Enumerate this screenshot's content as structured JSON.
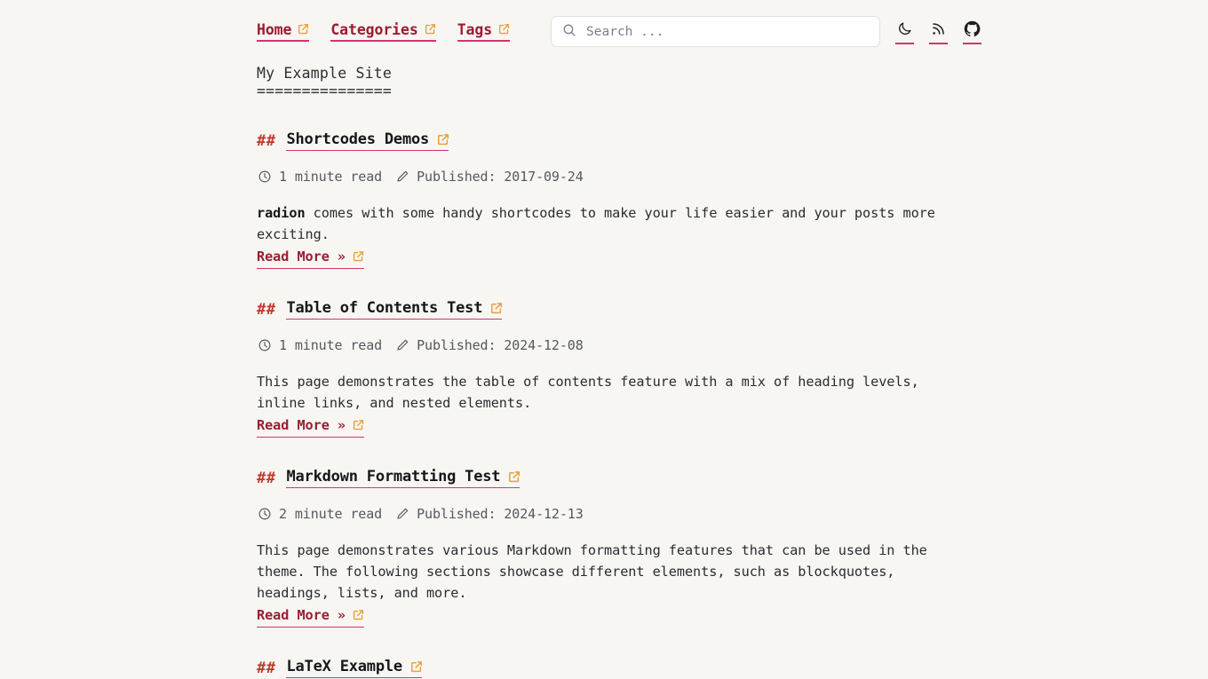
{
  "header": {
    "nav": [
      {
        "label": "Home",
        "icon": "external-link-icon"
      },
      {
        "label": "Categories",
        "icon": "external-link-icon"
      },
      {
        "label": "Tags",
        "icon": "external-link-icon"
      }
    ],
    "search": {
      "placeholder": "Search ...",
      "value": "",
      "icon": "search-icon"
    },
    "icons": [
      {
        "name": "moon-icon",
        "title": "Toggle dark mode"
      },
      {
        "name": "rss-icon",
        "title": "RSS feed"
      },
      {
        "name": "github-icon",
        "title": "GitHub"
      }
    ]
  },
  "site": {
    "title": "My Example Site",
    "rule": "==============="
  },
  "posts": [
    {
      "hash": "##",
      "title": "Shortcodes Demos",
      "read_time": "1 minute read",
      "published": "Published: 2017-09-24",
      "summary_lead": "radion",
      "summary": " comes with some handy shortcodes to make your life easier and your posts more exciting.",
      "read_more": "Read More »"
    },
    {
      "hash": "##",
      "title": "Table of Contents Test",
      "read_time": "1 minute read",
      "published": "Published: 2024-12-08",
      "summary_lead": "",
      "summary": "This page demonstrates the table of contents feature with a mix of heading levels, inline links, and nested elements.",
      "read_more": "Read More »"
    },
    {
      "hash": "##",
      "title": "Markdown Formatting Test",
      "read_time": "2 minute read",
      "published": "Published: 2024-12-13",
      "summary_lead": "",
      "summary": "This page demonstrates various Markdown formatting features that can be used in the theme. The following sections showcase different elements, such as blockquotes, headings, lists, and more.",
      "read_more": "Read More »"
    },
    {
      "hash": "##",
      "title": "LaTeX Example",
      "read_time": "",
      "published": "",
      "summary_lead": "",
      "summary": "",
      "read_more": ""
    }
  ],
  "colors": {
    "background": "#f7f6f3",
    "accent_underline": "#d6336c",
    "link_text": "#9b1c31",
    "hash_marker": "#c0392b",
    "external_icon": "#e8a13a",
    "meta_text": "#55585e",
    "body_text": "#2a2c30"
  }
}
